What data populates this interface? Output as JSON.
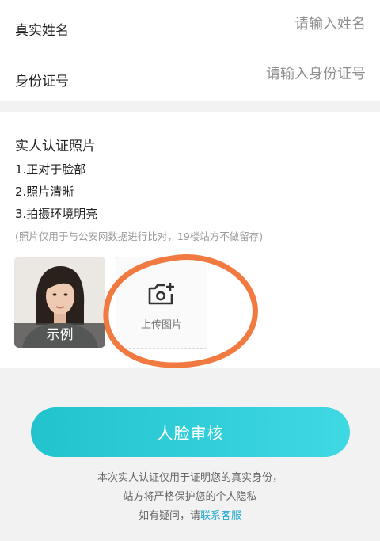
{
  "form": {
    "name_label": "真实姓名",
    "name_placeholder": "请输入姓名",
    "id_label": "身份证号",
    "id_placeholder": "请输入身份证号"
  },
  "photo_section": {
    "title": "实人认证照片",
    "requirements": [
      "1.正对于脸部",
      "2.照片清晰",
      "3.拍摄环境明亮"
    ],
    "note": "(照片仅用于与公安网数据进行比对，19楼站方不做留存)",
    "sample_label": "示例",
    "upload_label": "上传图片"
  },
  "submit_label": "人脸审核",
  "footer": {
    "line1": "本次实人认证仅用于证明您的真实身份，",
    "line2": "站方将严格保护您的个人隐私",
    "line3_prefix": "如有疑问，请",
    "contact_link": "联系客服"
  },
  "colors": {
    "accent": "#2fcfd9",
    "link": "#26a9cf",
    "annotation": "#f07a3f"
  }
}
